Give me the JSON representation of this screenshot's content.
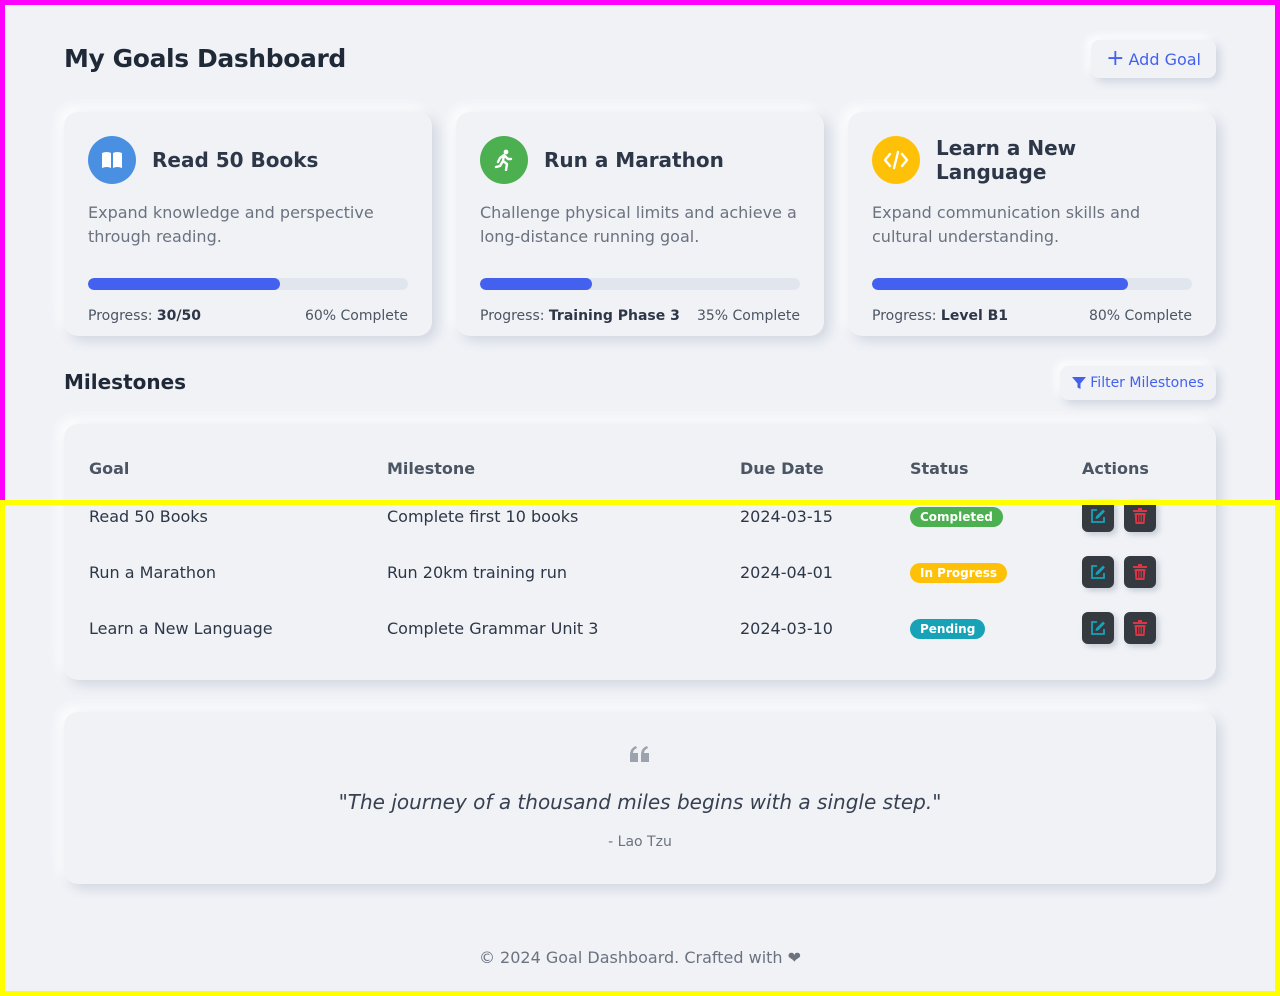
{
  "header": {
    "title": "My Goals Dashboard",
    "add_goal_label": "Add Goal"
  },
  "goals": [
    {
      "title": "Read 50 Books",
      "description": "Expand knowledge and perspective through reading.",
      "progress_label": "Progress:",
      "progress_value": "30/50",
      "complete_text": "60% Complete",
      "percent": 60,
      "icon": "book-open-icon",
      "icon_color": "#4a90e2"
    },
    {
      "title": "Run a Marathon",
      "description": "Challenge physical limits and achieve a long-distance running goal.",
      "progress_label": "Progress:",
      "progress_value": "Training Phase 3",
      "complete_text": "35% Complete",
      "percent": 35,
      "icon": "running-icon",
      "icon_color": "#4caf50"
    },
    {
      "title": "Learn a New Language",
      "description": "Expand communication skills and cultural understanding.",
      "progress_label": "Progress:",
      "progress_value": "Level B1",
      "complete_text": "80% Complete",
      "percent": 80,
      "icon": "code-icon",
      "icon_color": "#ffc107"
    }
  ],
  "milestones": {
    "title": "Milestones",
    "filter_label": "Filter Milestones",
    "columns": [
      "Goal",
      "Milestone",
      "Due Date",
      "Status",
      "Actions"
    ],
    "rows": [
      {
        "goal": "Read 50 Books",
        "milestone": "Complete first 10 books",
        "due": "2024-03-15",
        "status": "Completed",
        "status_color": "#4caf50"
      },
      {
        "goal": "Run a Marathon",
        "milestone": "Run 20km training run",
        "due": "2024-04-01",
        "status": "In Progress",
        "status_color": "#ffc107"
      },
      {
        "goal": "Learn a New Language",
        "milestone": "Complete Grammar Unit 3",
        "due": "2024-03-10",
        "status": "Pending",
        "status_color": "#17a2b8"
      }
    ]
  },
  "quote": {
    "text": "\"The journey of a thousand miles begins with a single step.\"",
    "author": "- Lao Tzu"
  },
  "footer": {
    "text": "© 2024 Goal Dashboard. Crafted with ❤"
  },
  "colors": {
    "accent": "#4361ee",
    "edit_icon": "#17a2b8",
    "delete_icon": "#dc3545"
  }
}
